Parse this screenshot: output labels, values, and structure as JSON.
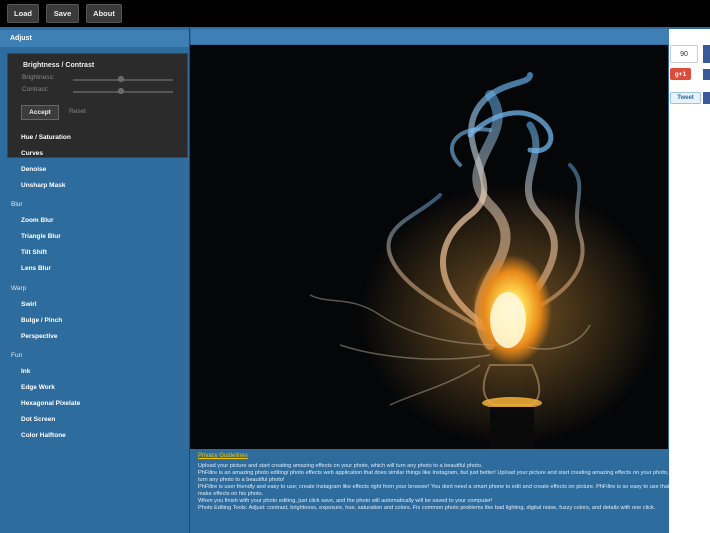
{
  "toolbar": {
    "load": "Load",
    "save": "Save",
    "about": "About"
  },
  "panel": {
    "header": "Adjust",
    "active_tool": {
      "title": "Brightness / Contrast",
      "brightness_label": "Brightness:",
      "contrast_label": "Contrast:",
      "brightness_value": 0.5,
      "contrast_value": 0.5,
      "accept": "Accept",
      "reset": "Reset"
    },
    "adjust_items": [
      "Hue / Saturation",
      "Curves",
      "Denoise",
      "Unsharp Mask"
    ],
    "blur_label": "Blur",
    "blur_items": [
      "Zoom Blur",
      "Triangle Blur",
      "Tilt Shift",
      "Lens Blur"
    ],
    "warp_label": "Warp",
    "warp_items": [
      "Swirl",
      "Bulge / Pinch",
      "Perspective"
    ],
    "fun_label": "Fun",
    "fun_items": [
      "Ink",
      "Edge Work",
      "Hexagonal Pixelate",
      "Dot Screen",
      "Color Halftone"
    ]
  },
  "content": {
    "privacy": "Privacy Guidelines",
    "paragraphs": [
      "Upload your picture and start creating amazing effects on your photo, which will turn any photo to a beautiful photo.",
      "PhFiltre is an amazing photo editing/ photo effects web application that does similar things like Instagram, but just better! Upload your picture and start creating amazing effects on your photo, which will turn any photo to a beautiful photo!",
      "PhFiltre is user friendly and easy to use; create Instagram like effects right from your browser! You dont need a smart phone to edit and create effects on picture. PhFiltre is so easy to use that anyone can make effects on his photo.",
      "When you finish with your photo editing, just click save, and the photo will automatically will be saved to your computer!",
      "Photo Editing Tools: Adjust: contrast, brightness, exposure, hue, saturation and colors. Fix common photo problems like bad lighting, digital noise, fuzzy colors, and details with one click."
    ]
  },
  "share": {
    "count": "90",
    "gplus": "g+1",
    "tweet": "Tweet"
  },
  "colors": {
    "panel": "#2f6c9e",
    "header": "#3e7fb6",
    "topbar": "#000000",
    "privacy_link": "#f2c500"
  }
}
